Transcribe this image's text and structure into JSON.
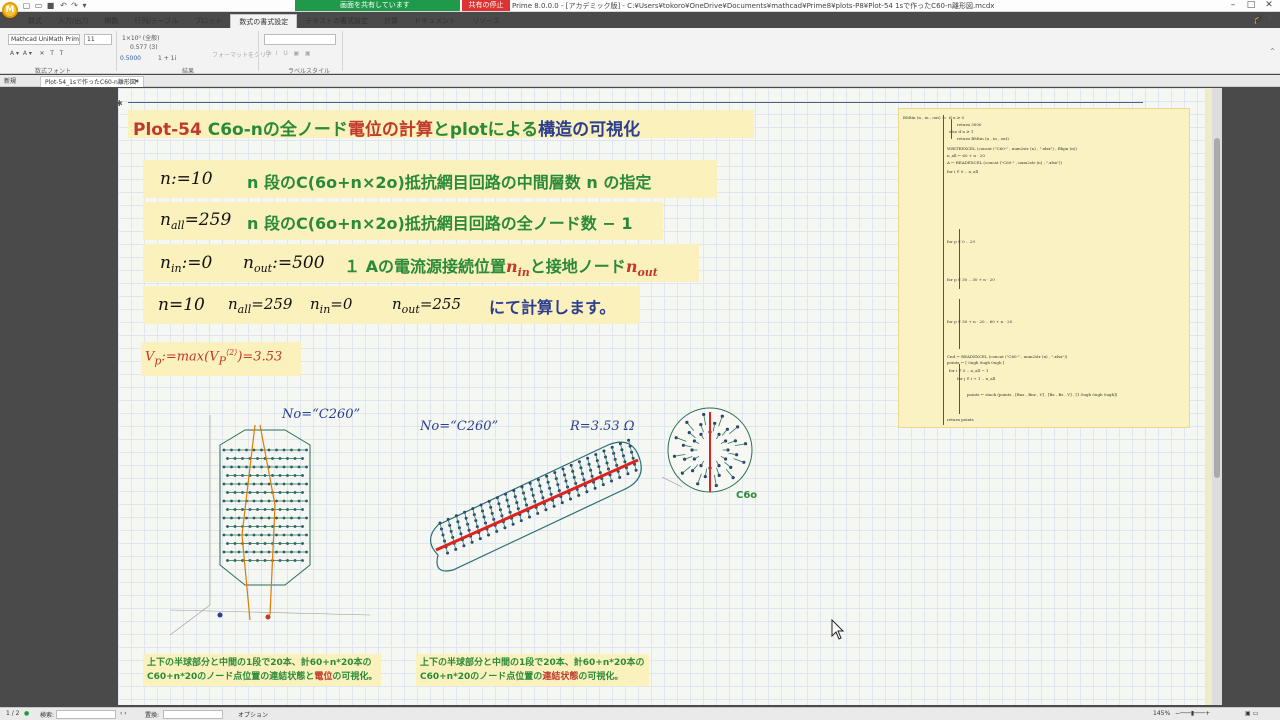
{
  "window": {
    "share_status": "画面を共有しています",
    "share_stop": "共有の停止",
    "title": "Prime 8.0.0.0 - [アカデミック版] - C:¥Users¥tokoro¥OneDrive¥Documents¥mathcad¥Prime8¥plots-P8¥Plot-54 1sで作ったC60-n離形図.mcdx"
  },
  "ribbon": {
    "tabs": [
      "数式",
      "入力/出力",
      "関数",
      "行列/テーブル",
      "プロット",
      "数式の書式設定",
      "テキストの書式設定",
      "計算",
      "ドキュメント",
      "リソース"
    ],
    "active_tab": "数式の書式設定",
    "font_name": "Mathcad UniMath Prim",
    "font_size": "11",
    "number_format_1": "1×10⁰ (全般)",
    "number_format_2": "0.577 (3)",
    "number_format_3": "0.5000",
    "number_format_4": "1 + 1i",
    "format_copy": "フォーマットをクリア",
    "group_font": "数式フォント",
    "group_result": "結果",
    "group_label": "ラベルスタイル"
  },
  "doc_tabs": {
    "home": "新規",
    "active": "Plot-54_1sで作ったC60-n離形図*"
  },
  "sheet": {
    "title_prefix": "Plot-54",
    "title_part1": " C6o-nの全ノード",
    "title_part2": "電位の計算",
    "title_part3": "とplotによる",
    "title_part4": "構造の可視化",
    "row1_math": "n:=10",
    "row1_desc": "n 段のC(6o+n×2o)抵抗網目回路の中間層数 n の指定",
    "row2_math": "nall=259",
    "row2_desc": "n 段のC(6o+n×2o)抵抗網目回路の全ノード数 − 1",
    "row3_math1": "nin:=0",
    "row3_math2": "nout:=500",
    "row3_desc": "１ Aの電流源接続位置",
    "row3_desc_mid": "と接地ノード",
    "row3_var_in": "nin",
    "row3_var_out": "nout",
    "row4_n": "n=10",
    "row4_nall": "nall=259",
    "row4_nin": "nin=0",
    "row4_nout": "nout=255",
    "row4_desc": "にて計算します。",
    "vp": "Vp:=max(Vp(2))=3.53",
    "plot1_label": "No=“C260”",
    "plot2_label": "No=“C260”",
    "plot2_r": "R=3.53 Ω",
    "c60_label": "C6o",
    "caption1_line1": "上下の半球部分と中間の1段で20本、計60+n*20本の",
    "caption1_line2a": "C60+n*20のノード点位置の連結状態と",
    "caption1_line2b": "電位",
    "caption1_line2c": "の可視化。",
    "caption2_line1": "上下の半球部分と中間の1段で20本、計60+n*20本の",
    "caption2_line2a": "C60+n*20のノード点位置の",
    "caption2_line2b": "連結状態",
    "caption2_line2c": "の可視化。"
  },
  "program": {
    "header": "BMtin (n , in , out) :=",
    "lines": [
      "if  n ≥ 0",
      "return  3000",
      "else if  n ≥ 1",
      "return  BMtin (n , in , out)",
      "WRITEEXCEL (concat (\"C60-\" , num2str (n) , \".xlsx\") , Bhpn (n))",
      "n_all ← 60 + n · 20",
      "A ← READEXCEL (concat (\"C60-\" , num2str (n) , \".xlsx\"))",
      "for  i ∈ 0 .. n_all",
      "for  p ∈ 0 .. 29",
      "for  p ∈ 30 .. 30 + n · 20",
      "for  p ∈ 30 + n · 20 .. 60 + n · 20",
      "Cnd ← READEXCEL (concat (\"C60-\" , num2str (n) , \".xlsx\"))",
      "points ← [ 0ugh  0ugh  0ugh ]",
      "for  i ∈ 0 .. n_all − 1",
      "for  j ∈ i + 1 .. n_all",
      "points ← stack (points , [Bnz , Bnz , V] , [Bz , Bz , V] , [1.0ugh  0ugh  0ugh])",
      "return  points"
    ]
  },
  "statusbar": {
    "page": "1 / 2",
    "find_label": "検索:",
    "replace_label": "置換:",
    "options": "オプション",
    "zoom": "145%"
  }
}
